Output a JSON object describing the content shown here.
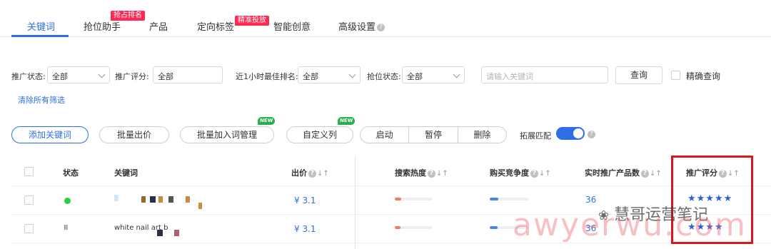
{
  "tabs": [
    {
      "label": "关键词"
    },
    {
      "label": "抢位助手",
      "badge": "抢占排名"
    },
    {
      "label": "产品"
    },
    {
      "label": "定向标签",
      "badge": "精准投放"
    },
    {
      "label": "智能创意"
    },
    {
      "label": "高级设置"
    }
  ],
  "filters": {
    "status_label": "推广状态:",
    "status_value": "全部",
    "score_label": "推广评分:",
    "score_value": "全部",
    "rank_label": "近1小时最佳排名:",
    "rank_value": "全部",
    "grab_label": "抢位状态:",
    "grab_value": "全部",
    "keyword_placeholder": "请输入关键词",
    "query_button": "查询",
    "exact_label": "精确查询",
    "clear_all": "清除所有筛选"
  },
  "toolbar": {
    "add_keyword": "添加关键词",
    "bulk_bid": "批量出价",
    "bulk_add_words": "批量加入词管理",
    "custom_columns": "自定义列",
    "new_badge": "NEW",
    "start": "启动",
    "pause": "暂停",
    "delete": "删除",
    "expand_match": "拓展匹配"
  },
  "table": {
    "headers": {
      "status": "状态",
      "keyword": "关键词",
      "bid": "出价",
      "search_heat": "搜索热度",
      "competition": "购买竞争度",
      "live_products": "实时推广产品数",
      "score": "推广评分"
    },
    "rows": [
      {
        "status": "active",
        "keyword": "",
        "bid": "¥ 3.1",
        "heat": 0.18,
        "competition": 0.22,
        "products": "36",
        "stars": "★★★★★"
      },
      {
        "status": "paused",
        "status_icon": "II",
        "keyword": "white nail art b",
        "bid": "¥ 3.1",
        "heat": 0.16,
        "competition": 0.2,
        "products": "36",
        "stars": "★★★★"
      }
    ]
  },
  "watermark": {
    "channel": "慧哥运营笔记",
    "site": "awyerwu.com"
  },
  "colors": {
    "accent": "#2f6fe4",
    "badge_red": "#ff2b55",
    "new_green": "#22b14c",
    "highlight": "#e0141e",
    "heat_fill": "#f47d5b",
    "competition_fill": "#4a86e8"
  }
}
